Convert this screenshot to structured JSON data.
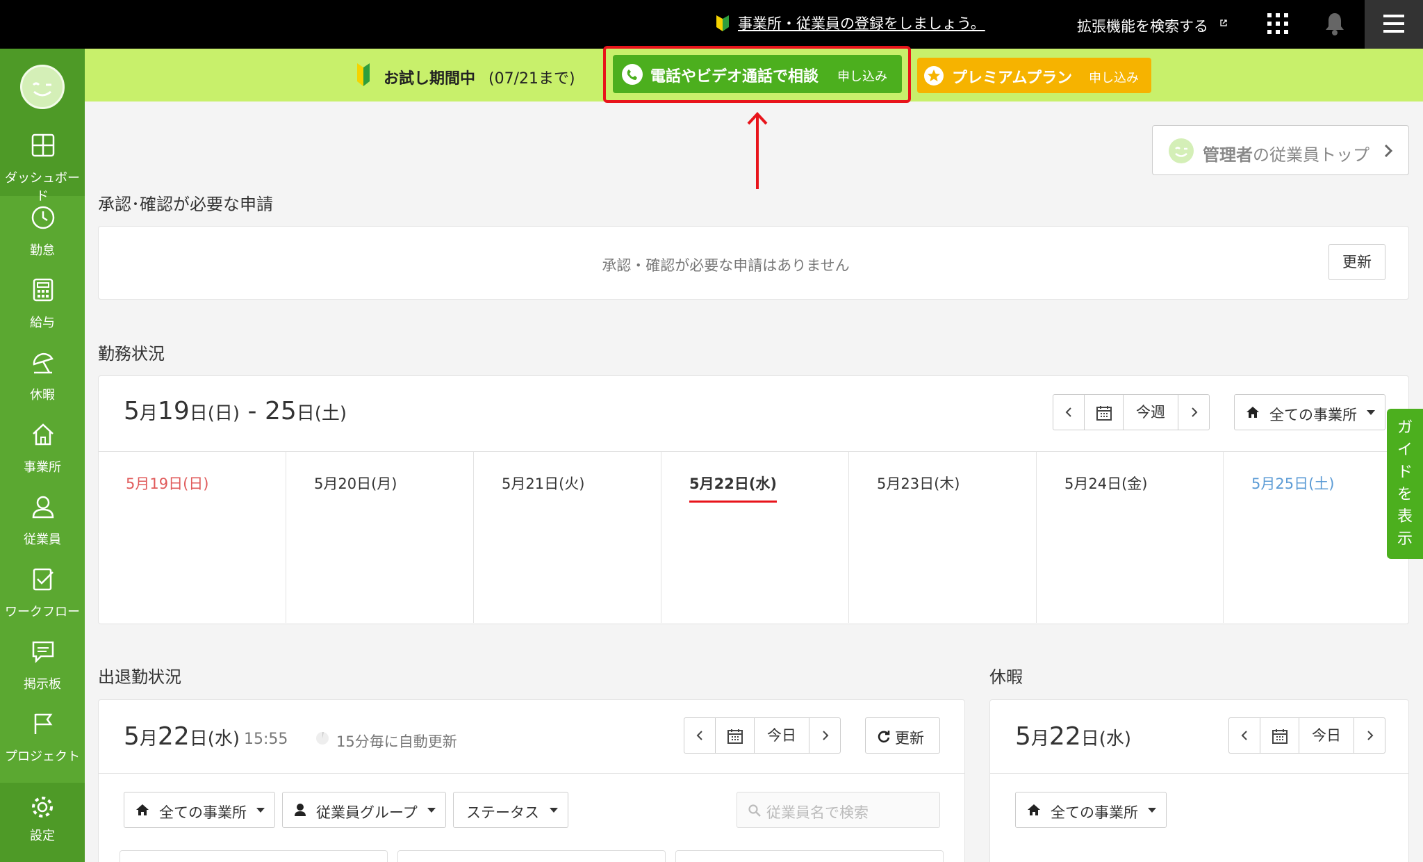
{
  "topbar": {
    "register_notice": "事業所・従業員の登録をしましょう。",
    "extensions_link": "拡張機能を検索する"
  },
  "trial": {
    "label": "お試し期間中",
    "until": "(07/21まで)",
    "consult_label": "電話やビデオ通話で相談",
    "consult_apply": "申し込み",
    "premium_label": "プレミアムプラン",
    "premium_apply": "申し込み"
  },
  "sidebar": {
    "items": [
      {
        "label": "ダッシュボード"
      },
      {
        "label": "勤怠"
      },
      {
        "label": "給与"
      },
      {
        "label": "休暇"
      },
      {
        "label": "事業所"
      },
      {
        "label": "従業員"
      },
      {
        "label": "ワークフロー"
      },
      {
        "label": "掲示板"
      },
      {
        "label": "プロジェクト"
      },
      {
        "label": "設定"
      }
    ]
  },
  "admin_link": {
    "bold": "管理者",
    "rest": "の従業員トップ"
  },
  "approvals": {
    "title": "承認･確認が必要な申請",
    "empty_text": "承認・確認が必要な申請はありません",
    "refresh_label": "更新"
  },
  "work_status": {
    "title": "勤務状況",
    "range": {
      "m1": "5",
      "t1": "月",
      "d1": "19",
      "t2": "日",
      "w1": "(日)",
      "sep": " - ",
      "d2": "25",
      "t3": "日",
      "w2": "(土)"
    },
    "nav": {
      "today_label": "今週"
    },
    "office_select": "全ての事業所",
    "days": [
      {
        "label": "5月19日(日)",
        "color": "#e05a5a"
      },
      {
        "label": "5月20日(月)",
        "color": "#333333"
      },
      {
        "label": "5月21日(火)",
        "color": "#333333"
      },
      {
        "label": "5月22日(水)",
        "color": "#333333"
      },
      {
        "label": "5月23日(木)",
        "color": "#333333"
      },
      {
        "label": "5月24日(金)",
        "color": "#333333"
      },
      {
        "label": "5月25日(土)",
        "color": "#5b9bd5"
      }
    ]
  },
  "attendance": {
    "title": "出退勤状況",
    "date": {
      "m": "5",
      "t1": "月",
      "d": "22",
      "t2": "日",
      "w": "(水)"
    },
    "time": "15:55",
    "auto_update": "15分毎に自動更新",
    "today_label": "今日",
    "refresh_label": "更新",
    "office_filter": "全ての事業所",
    "group_filter": "従業員グループ",
    "status_filter": "ステータス",
    "search_placeholder": "従業員名で検索"
  },
  "leave": {
    "title": "休暇",
    "date": {
      "m": "5",
      "t1": "月",
      "d": "22",
      "t2": "日",
      "w": "(水)"
    },
    "today_label": "今日",
    "office_filter": "全ての事業所"
  },
  "guide": {
    "label": "ガイドを表示"
  },
  "colors": {
    "sidebar": "#5ba831",
    "trial_bar": "#c8f06b",
    "consult": "#4caf1e",
    "premium": "#f6b300",
    "highlight": "#e8141b"
  }
}
